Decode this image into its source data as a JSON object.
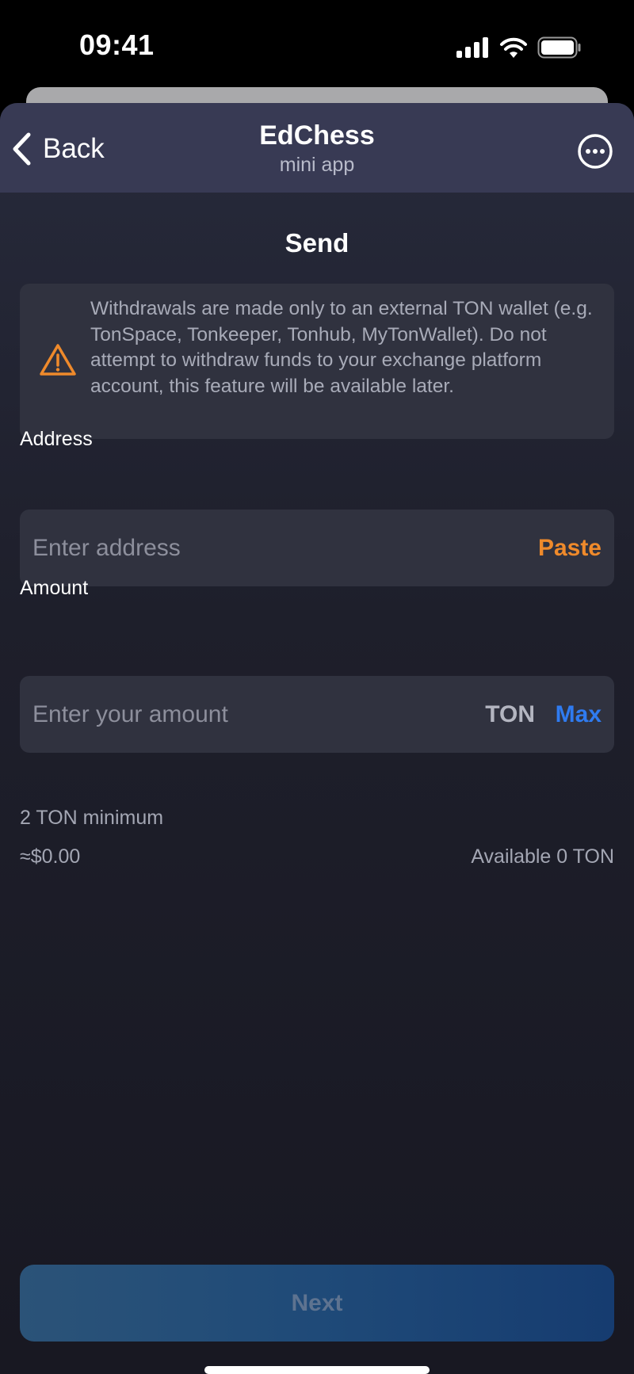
{
  "status_bar": {
    "time": "09:41",
    "icons": [
      "cellular-signal-icon",
      "wifi-icon",
      "battery-icon"
    ]
  },
  "nav": {
    "back_label": "Back",
    "title": "EdChess",
    "subtitle": "mini app",
    "more_icon": "ellipsis-circle-icon"
  },
  "page": {
    "title": "Send"
  },
  "warning": {
    "icon": "warning-triangle-icon",
    "text": "Withdrawals are made only to an external TON wallet (e.g. TonSpace, Tonkeeper, Tonhub, MyTonWallet). Do not attempt to withdraw funds to your exchange platform account, this feature will be available later."
  },
  "address": {
    "label": "Address",
    "value": "",
    "placeholder": "Enter address",
    "paste_label": "Paste"
  },
  "amount": {
    "label": "Amount",
    "value": "",
    "placeholder": "Enter your amount",
    "unit": "TON",
    "max_label": "Max"
  },
  "info": {
    "minimum": "2 TON minimum",
    "usd_value": "≈$0.00",
    "available": "Available 0 TON"
  },
  "next_button": {
    "label": "Next"
  },
  "colors": {
    "accent_orange": "#ef8a2b",
    "accent_blue": "#2f7bf0",
    "nav_background": "#383a54",
    "field_background": "#30323f"
  }
}
